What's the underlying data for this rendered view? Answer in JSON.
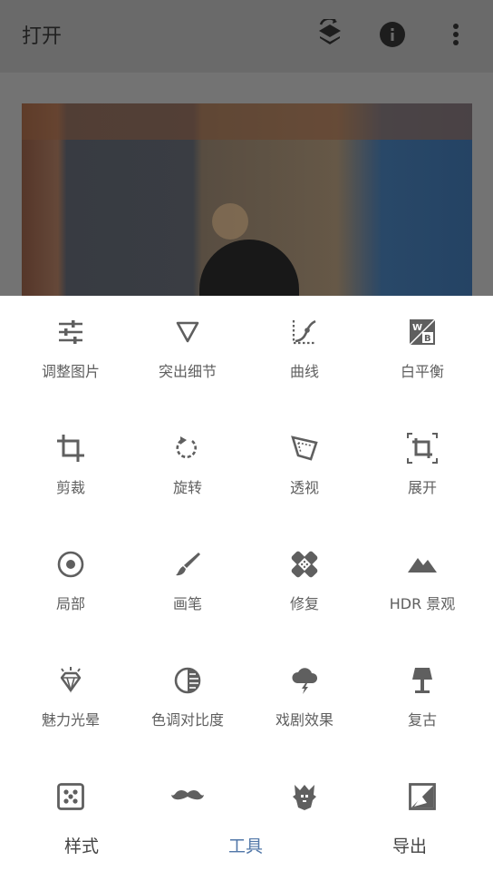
{
  "header": {
    "title": "打开",
    "icons": [
      "layers-rotate-icon",
      "info-icon",
      "more-vertical-icon"
    ]
  },
  "tools": [
    {
      "label": "调整图片",
      "icon": "tune-sliders-icon"
    },
    {
      "label": "突出细节",
      "icon": "details-triangle-icon"
    },
    {
      "label": "曲线",
      "icon": "curves-icon"
    },
    {
      "label": "白平衡",
      "icon": "white-balance-icon"
    },
    {
      "label": "剪裁",
      "icon": "crop-icon"
    },
    {
      "label": "旋转",
      "icon": "rotate-icon"
    },
    {
      "label": "透视",
      "icon": "perspective-icon"
    },
    {
      "label": "展开",
      "icon": "expand-icon"
    },
    {
      "label": "局部",
      "icon": "selective-icon"
    },
    {
      "label": "画笔",
      "icon": "brush-icon"
    },
    {
      "label": "修复",
      "icon": "healing-icon"
    },
    {
      "label": "HDR 景观",
      "icon": "hdr-mountain-icon"
    },
    {
      "label": "魅力光晕",
      "icon": "glamour-glow-icon"
    },
    {
      "label": "色调对比度",
      "icon": "tonal-contrast-icon"
    },
    {
      "label": "戏剧效果",
      "icon": "drama-cloud-icon"
    },
    {
      "label": "复古",
      "icon": "vintage-lamp-icon"
    },
    {
      "label": "",
      "icon": "grainy-film-icon"
    },
    {
      "label": "",
      "icon": "mustache-icon"
    },
    {
      "label": "",
      "icon": "grunge-icon"
    },
    {
      "label": "",
      "icon": "black-white-icon"
    }
  ],
  "bottom_tabs": [
    {
      "label": "样式",
      "active": false
    },
    {
      "label": "工具",
      "active": true
    },
    {
      "label": "导出",
      "active": false
    }
  ],
  "colors": {
    "accent": "#5177a8",
    "icon": "#5f5f5f",
    "label": "#5f5f5f"
  }
}
